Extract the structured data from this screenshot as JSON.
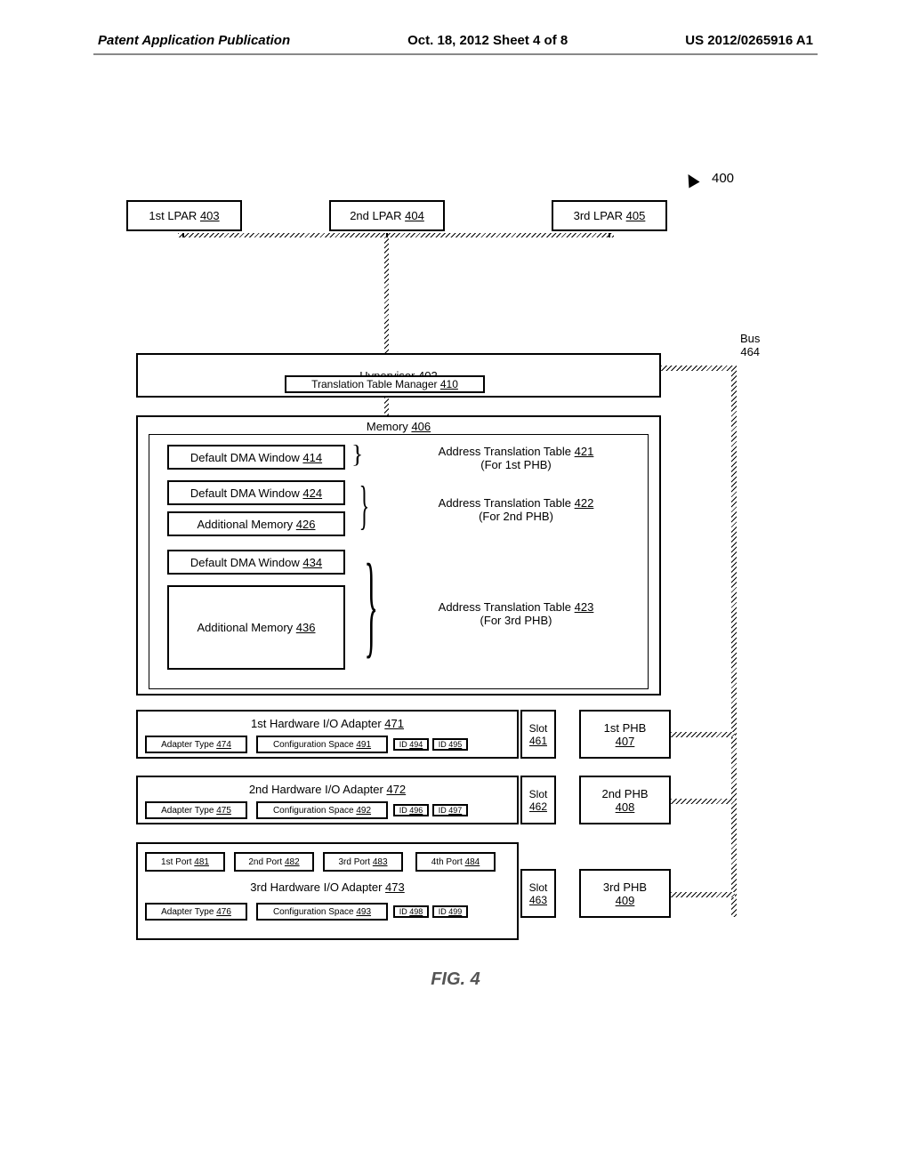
{
  "header": {
    "left": "Patent Application Publication",
    "mid": "Oct. 18, 2012  Sheet 4 of 8",
    "right": "US 2012/0265916 A1"
  },
  "refnum": "400",
  "bus_label": "Bus",
  "bus_ref": "464",
  "lpar1": {
    "label": "1st LPAR",
    "ref": "403"
  },
  "lpar2": {
    "label": "2nd LPAR",
    "ref": "404"
  },
  "lpar3": {
    "label": "3rd LPAR",
    "ref": "405"
  },
  "hypervisor": {
    "label": "Hypervisor",
    "ref": "402"
  },
  "ttm": {
    "label": "Translation Table Manager",
    "ref": "410"
  },
  "memory": {
    "label": "Memory",
    "ref": "406"
  },
  "dma414": {
    "label": "Default DMA Window",
    "ref": "414"
  },
  "dma424": {
    "label": "Default DMA Window",
    "ref": "424"
  },
  "add426": {
    "label": "Additional Memory",
    "ref": "426"
  },
  "dma434": {
    "label": "Default DMA Window",
    "ref": "434"
  },
  "add436": {
    "label": "Additional Memory",
    "ref": "436"
  },
  "att421": {
    "label": "Address Translation Table",
    "ref": "421",
    "sub": "(For 1st PHB)"
  },
  "att422": {
    "label": "Address Translation Table",
    "ref": "422",
    "sub": "(For 2nd PHB)"
  },
  "att423": {
    "label": "Address Translation Table",
    "ref": "423",
    "sub": "(For 3rd PHB)"
  },
  "adp471": {
    "label": "1st Hardware I/O Adapter",
    "ref": "471"
  },
  "adp472": {
    "label": "2nd Hardware I/O Adapter",
    "ref": "472"
  },
  "adp473": {
    "label": "3rd Hardware I/O Adapter",
    "ref": "473"
  },
  "atype474": {
    "label": "Adapter Type",
    "ref": "474"
  },
  "atype475": {
    "label": "Adapter Type",
    "ref": "475"
  },
  "atype476": {
    "label": "Adapter Type",
    "ref": "476"
  },
  "cfg491": {
    "label": "Configuration Space",
    "ref": "491"
  },
  "cfg492": {
    "label": "Configuration Space",
    "ref": "492"
  },
  "cfg493": {
    "label": "Configuration Space",
    "ref": "493"
  },
  "id494": {
    "label": "ID",
    "ref": "494"
  },
  "id495": {
    "label": "ID",
    "ref": "495"
  },
  "id496": {
    "label": "ID",
    "ref": "496"
  },
  "id497": {
    "label": "ID",
    "ref": "497"
  },
  "id498": {
    "label": "ID",
    "ref": "498"
  },
  "id499": {
    "label": "ID",
    "ref": "499"
  },
  "slot461": {
    "label": "Slot",
    "ref": "461"
  },
  "slot462": {
    "label": "Slot",
    "ref": "462"
  },
  "slot463": {
    "label": "Slot",
    "ref": "463"
  },
  "phb407": {
    "label": "1st PHB",
    "ref": "407"
  },
  "phb408": {
    "label": "2nd PHB",
    "ref": "408"
  },
  "phb409": {
    "label": "3rd PHB",
    "ref": "409"
  },
  "port481": {
    "label": "1st Port",
    "ref": "481"
  },
  "port482": {
    "label": "2nd Port",
    "ref": "482"
  },
  "port483": {
    "label": "3rd Port",
    "ref": "483"
  },
  "port484": {
    "label": "4th Port",
    "ref": "484"
  },
  "figcap": "FIG. 4"
}
